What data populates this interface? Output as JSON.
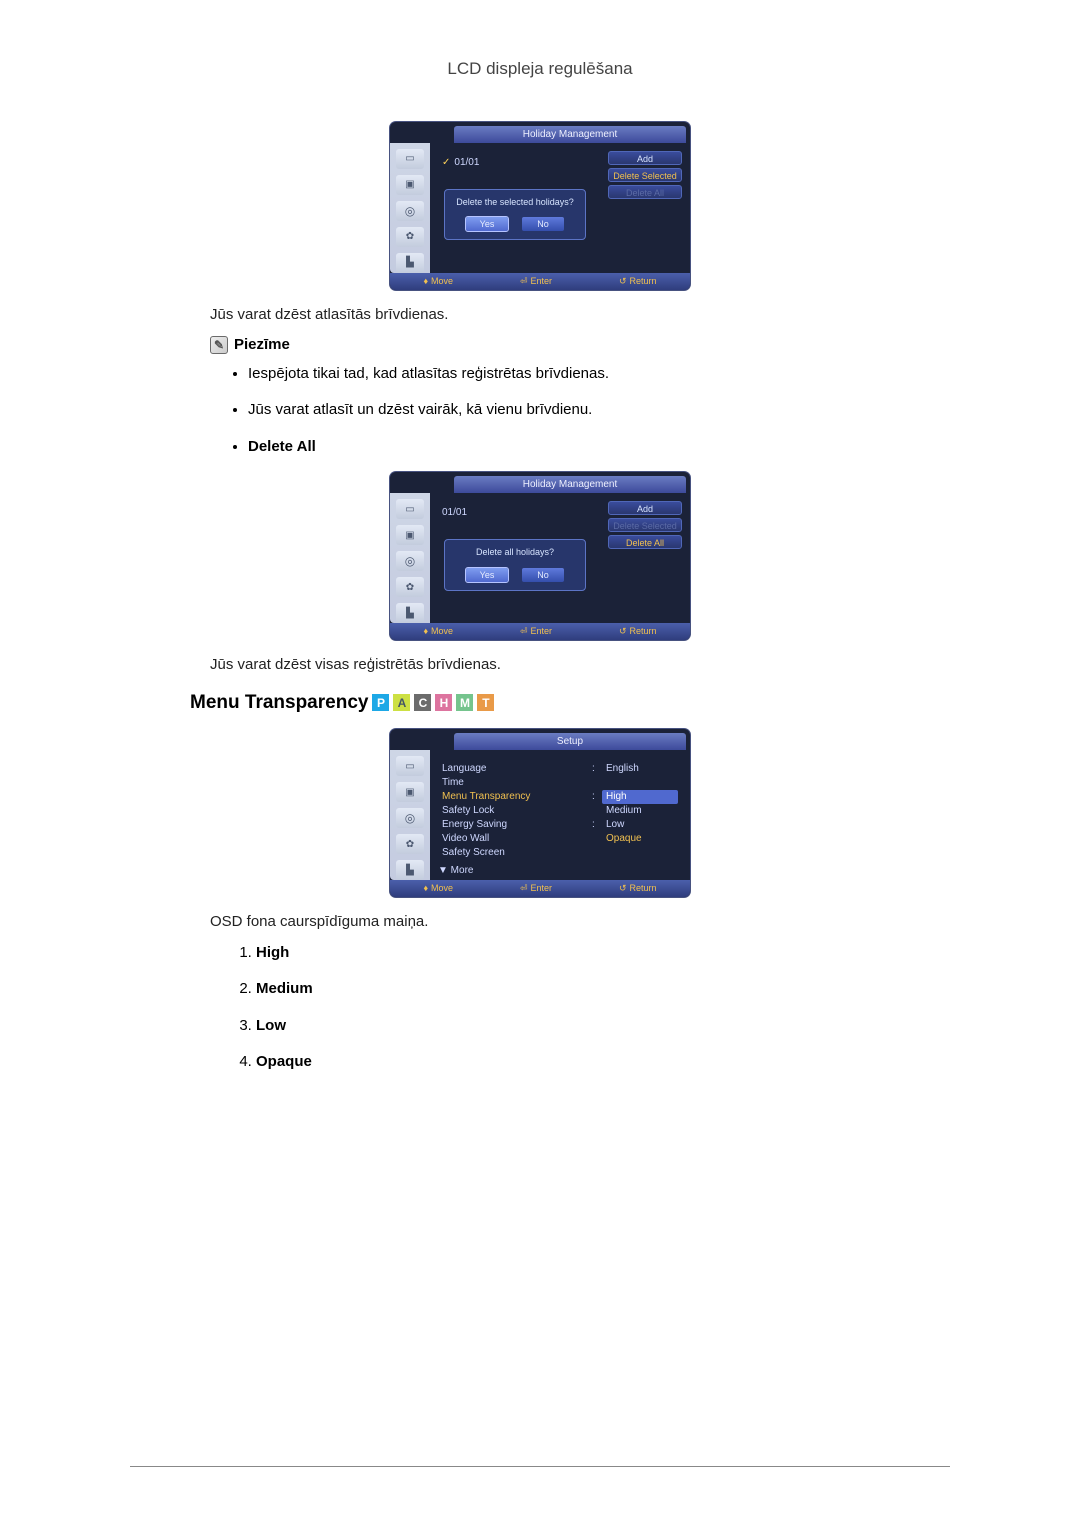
{
  "page_header": "LCD displeja regulēšana",
  "osd1": {
    "title": "Holiday Management",
    "date": "01/01",
    "buttons": {
      "add": "Add",
      "delete_selected": "Delete Selected",
      "delete_all": "Delete All"
    },
    "dialog_text": "Delete the selected holidays?",
    "yes": "Yes",
    "no": "No",
    "footer": {
      "move": "Move",
      "enter": "Enter",
      "return": "Return"
    }
  },
  "para_delete_selected": "Jūs varat dzēst atlasītās brīvdienas.",
  "note_label": "Piezīme",
  "note_bullets": [
    "Iespējota tikai tad, kad atlasītas reģistrētas brīvdienas.",
    "Jūs varat atlasīt un dzēst vairāk, kā vienu brīvdienu."
  ],
  "delete_all_label": "Delete All",
  "osd2": {
    "title": "Holiday Management",
    "date": "01/01",
    "buttons": {
      "add": "Add",
      "delete_selected": "Delete Selected",
      "delete_all": "Delete All"
    },
    "dialog_text": "Delete all holidays?",
    "yes": "Yes",
    "no": "No",
    "footer": {
      "move": "Move",
      "enter": "Enter",
      "return": "Return"
    }
  },
  "para_delete_all": "Jūs varat dzēst visas reģistrētās brīvdienas.",
  "heading_menu_transparency": "Menu Transparency",
  "badges": {
    "p": "P",
    "a": "A",
    "c": "C",
    "h": "H",
    "m": "M",
    "t": "T"
  },
  "osd3": {
    "title": "Setup",
    "rows": [
      {
        "label": "Language",
        "sep": ":",
        "value": "English",
        "hl": false,
        "opt": false
      },
      {
        "label": "Time",
        "sep": "",
        "value": "",
        "hl": false,
        "opt": false
      },
      {
        "label": "Menu Transparency",
        "sep": ":",
        "value": "High",
        "hl": true,
        "opt": true,
        "selected": true
      },
      {
        "label": "Safety Lock",
        "sep": "",
        "value": "Medium",
        "hl": false,
        "opt": true
      },
      {
        "label": "Energy Saving",
        "sep": ":",
        "value": "Low",
        "hl": false,
        "opt": true
      },
      {
        "label": "Video Wall",
        "sep": "",
        "value": "Opaque",
        "hl": false,
        "opt": true,
        "val_hl": true
      },
      {
        "label": "Safety Screen",
        "sep": "",
        "value": "",
        "hl": false,
        "opt": false
      }
    ],
    "more": "▼ More",
    "footer": {
      "move": "Move",
      "enter": "Enter",
      "return": "Return"
    }
  },
  "para_transparency_desc": "OSD fona caurspīdīguma maiņa.",
  "options": [
    "High",
    "Medium",
    "Low",
    "Opaque"
  ]
}
